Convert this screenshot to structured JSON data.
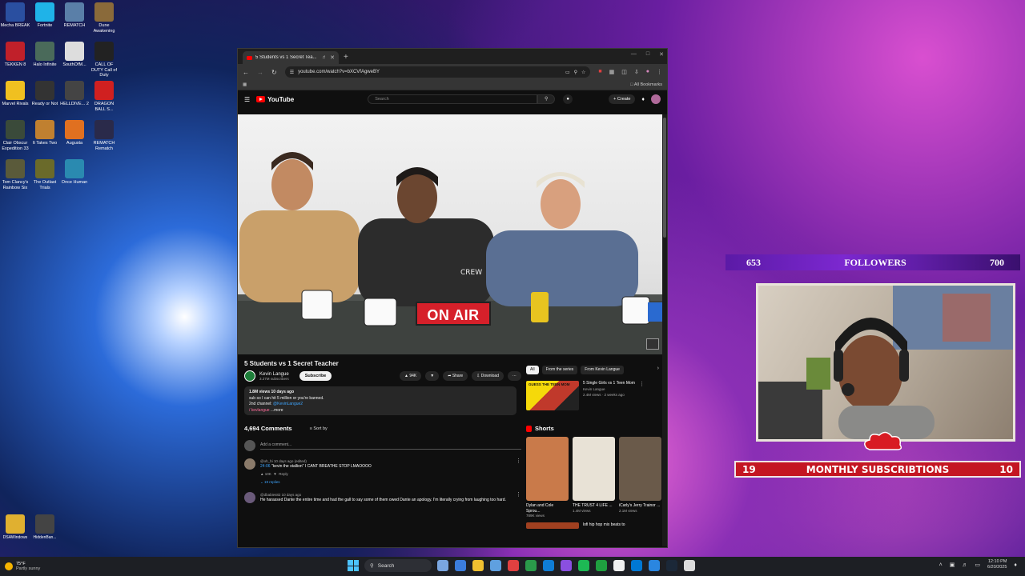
{
  "desktop": {
    "icons": [
      {
        "label": "Mecha BREAK",
        "color": "#2a4fa0"
      },
      {
        "label": "Fortnite",
        "color": "#1fb3e8"
      },
      {
        "label": "REMATCH",
        "color": "#5a7fa8"
      },
      {
        "label": "Dune Awakening",
        "color": "#8a6a3a"
      },
      {
        "label": "TEKKEN 8",
        "color": "#c0202a"
      },
      {
        "label": "Halo Infinite",
        "color": "#4a6a5a"
      },
      {
        "label": "SouthOfM...",
        "color": "#dddddd"
      },
      {
        "label": "CALL OF DUTY Call of Duty",
        "color": "#222222"
      },
      {
        "label": "Marvel Rivals",
        "color": "#f0c020"
      },
      {
        "label": "Ready or Not",
        "color": "#333333"
      },
      {
        "label": "HELLDIVE... 2",
        "color": "#444444"
      },
      {
        "label": "DRAGON BALL S...",
        "color": "#d02020"
      },
      {
        "label": "Clair Obscur Expedition 33",
        "color": "#3a4a3a"
      },
      {
        "label": "It Takes Two",
        "color": "#c08030"
      },
      {
        "label": "Augusta",
        "color": "#e07020"
      },
      {
        "label": "REMATCH Rematch",
        "color": "#2a2a4a"
      },
      {
        "label": "Tom Clancy's Rainbow Six",
        "color": "#5a5a3a"
      },
      {
        "label": "The Outlast Trials",
        "color": "#6a6a2a"
      },
      {
        "label": "Once Human",
        "color": "#2a8ab0"
      }
    ],
    "bottom_icons": [
      {
        "label": "DSAWindows",
        "color": "#e0b030"
      },
      {
        "label": "HiddenBan...",
        "color": "#444444"
      }
    ]
  },
  "browser": {
    "tab_title": "5 Students vs 1 Secret Tea...",
    "new_tab": "+",
    "url": "youtube.com/watch?v=bXCVfAgweBY",
    "bookmarks_label": "All Bookmarks"
  },
  "youtube": {
    "logo_text": "YouTube",
    "search_placeholder": "Search",
    "create_label": "+ Create",
    "video_title": "5 Students vs 1 Secret Teacher",
    "channel_name": "Kevin Langue",
    "channel_subs": "3.27M subscribers",
    "subscribe_label": "Subscribe",
    "likes": "94K",
    "share_label": "Share",
    "download_label": "Download",
    "onair_sign": "ON AIR",
    "description": {
      "views_line": "1.8M views  10 days ago",
      "line1": "sub so I can hit 5 million or you're banned.",
      "line2_prefix": "2nd channel: ",
      "line2_link": "@KevinLangue2",
      "line3": "/ kevlangue",
      "more": "...more"
    },
    "comments_count": "4,694 Comments",
    "sort_by": "Sort by",
    "add_comment": "Add a comment...",
    "comments": [
      {
        "meta": "@oh_hi  10 days ago (edited)",
        "text_time": "24:06",
        "text": "\"kevin the stallion\" I CANT BREATHE STOP LMAOOOO",
        "likes": "10K",
        "reply": "Reply",
        "replies": "19 replies"
      },
      {
        "meta": "@dbabies82  10 days ago",
        "text": "He harassed Dante the entire time and had the gall to say some of them owed Dante an apology. I'm literally crying from laughing too hard."
      }
    ],
    "chips": [
      "All",
      "From the series",
      "From Kevin Langue"
    ],
    "recommended": {
      "thumb_text": "GUESS THE TEEN MOM",
      "title": "5 Single Girls vs 1 Teen Mom",
      "channel": "Kevin Langue",
      "meta": "2.4M views · 2 weeks ago"
    },
    "shorts_label": "Shorts",
    "shorts": [
      {
        "title": "Dylan and Cole Sprou...",
        "views": "789K views",
        "color": "#c97a4a"
      },
      {
        "title": "THE TRUST 4 LIFE ...",
        "views": "1.4M views",
        "color": "#e8e2d6"
      },
      {
        "title": "iCarly's Jerry Trainor ...",
        "views": "2.1M views",
        "color": "#6a5a4a"
      }
    ],
    "bottom_reco": "lofi hip hop mix  beats to"
  },
  "overlay": {
    "followers_current": "653",
    "followers_label": "FOLLOWERS",
    "followers_goal": "700",
    "subs_current": "19",
    "subs_label": "MONTHLY SUBSCRIBTIONS",
    "subs_goal": "10"
  },
  "taskbar": {
    "weather_temp": "75°F",
    "weather_desc": "Partly sunny",
    "search_label": "Search",
    "time": "12:10 PM",
    "date": "6/20/2025",
    "apps": [
      "#7aa6e0",
      "#3b7ddd",
      "#f0c030",
      "#5fa0e0",
      "#e04040",
      "#2a9a4a",
      "#0f7dd6",
      "#8a4fe0",
      "#1db954",
      "#1fa040",
      "#f0f0f0",
      "#0078d4",
      "#2a86e0",
      "#1b2838",
      "#dcdcdc"
    ]
  }
}
